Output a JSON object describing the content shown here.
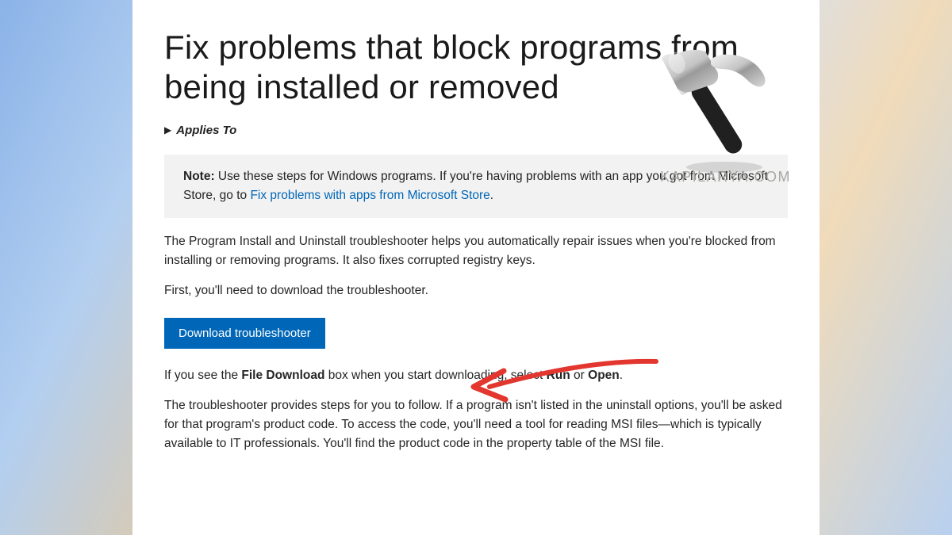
{
  "title": "Fix problems that block programs from being installed or removed",
  "applies_to_label": "Applies To",
  "note": {
    "label": "Note:",
    "text_before_link": " Use these steps for Windows programs. If you're having problems with an app you got from Microsoft Store, go to ",
    "link_text": "Fix problems with apps from Microsoft Store",
    "text_after_link": "."
  },
  "para1": "The Program Install and Uninstall troubleshooter helps you automatically repair issues when you're blocked from installing or removing programs. It also fixes corrupted registry keys.",
  "para2": "First, you'll need to download the troubleshooter.",
  "download_button": "Download troubleshooter",
  "para3": {
    "t1": "If you see the ",
    "b1": "File Download",
    "t2": " box when you start downloading, select ",
    "b2": "Run",
    "t3": " or ",
    "b3": "Open",
    "t4": "."
  },
  "para4": "The troubleshooter provides steps for you to follow. If a program isn't listed in the uninstall options, you'll be asked for that program's product code. To access the code, you'll need a tool for reading MSI files—which is typically available to IT professionals. You'll find the product code in the property table of the MSI file.",
  "watermark": "KAPILARYA.COM"
}
